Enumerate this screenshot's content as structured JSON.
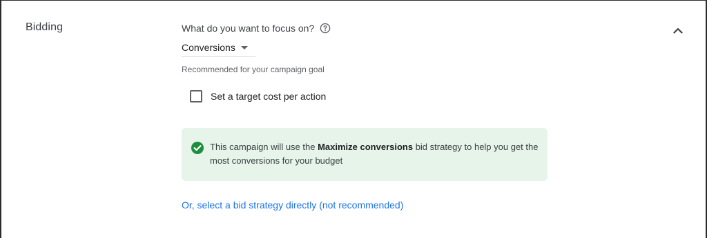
{
  "section": {
    "label": "Bidding"
  },
  "question": {
    "text": "What do you want to focus on?",
    "help_icon": "help-circle-icon"
  },
  "focus_dropdown": {
    "value": "Conversions"
  },
  "helper_text": "Recommended for your campaign goal",
  "target_cost": {
    "label": "Set a target cost per action",
    "checked": false
  },
  "info": {
    "prefix": "This campaign will use the ",
    "strategy": "Maximize conversions",
    "suffix": " bid strategy to help you get the most conversions for your budget",
    "icon": "check-circle-icon",
    "background": "#e6f4ea",
    "icon_color": "#1e8e3e"
  },
  "link_text": "Or, select a bid strategy directly (not recommended)",
  "collapse_icon": "chevron-up-icon",
  "colors": {
    "link": "#1a73e8"
  }
}
